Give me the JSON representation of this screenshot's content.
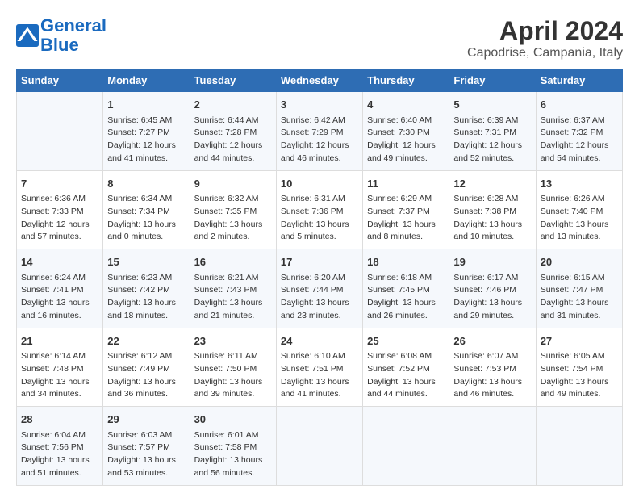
{
  "header": {
    "logo_line1": "General",
    "logo_line2": "Blue",
    "title": "April 2024",
    "subtitle": "Capodrise, Campania, Italy"
  },
  "columns": [
    "Sunday",
    "Monday",
    "Tuesday",
    "Wednesday",
    "Thursday",
    "Friday",
    "Saturday"
  ],
  "weeks": [
    {
      "cells": [
        {
          "day": "",
          "info": ""
        },
        {
          "day": "1",
          "info": "Sunrise: 6:45 AM\nSunset: 7:27 PM\nDaylight: 12 hours\nand 41 minutes."
        },
        {
          "day": "2",
          "info": "Sunrise: 6:44 AM\nSunset: 7:28 PM\nDaylight: 12 hours\nand 44 minutes."
        },
        {
          "day": "3",
          "info": "Sunrise: 6:42 AM\nSunset: 7:29 PM\nDaylight: 12 hours\nand 46 minutes."
        },
        {
          "day": "4",
          "info": "Sunrise: 6:40 AM\nSunset: 7:30 PM\nDaylight: 12 hours\nand 49 minutes."
        },
        {
          "day": "5",
          "info": "Sunrise: 6:39 AM\nSunset: 7:31 PM\nDaylight: 12 hours\nand 52 minutes."
        },
        {
          "day": "6",
          "info": "Sunrise: 6:37 AM\nSunset: 7:32 PM\nDaylight: 12 hours\nand 54 minutes."
        }
      ]
    },
    {
      "cells": [
        {
          "day": "7",
          "info": "Sunrise: 6:36 AM\nSunset: 7:33 PM\nDaylight: 12 hours\nand 57 minutes."
        },
        {
          "day": "8",
          "info": "Sunrise: 6:34 AM\nSunset: 7:34 PM\nDaylight: 13 hours\nand 0 minutes."
        },
        {
          "day": "9",
          "info": "Sunrise: 6:32 AM\nSunset: 7:35 PM\nDaylight: 13 hours\nand 2 minutes."
        },
        {
          "day": "10",
          "info": "Sunrise: 6:31 AM\nSunset: 7:36 PM\nDaylight: 13 hours\nand 5 minutes."
        },
        {
          "day": "11",
          "info": "Sunrise: 6:29 AM\nSunset: 7:37 PM\nDaylight: 13 hours\nand 8 minutes."
        },
        {
          "day": "12",
          "info": "Sunrise: 6:28 AM\nSunset: 7:38 PM\nDaylight: 13 hours\nand 10 minutes."
        },
        {
          "day": "13",
          "info": "Sunrise: 6:26 AM\nSunset: 7:40 PM\nDaylight: 13 hours\nand 13 minutes."
        }
      ]
    },
    {
      "cells": [
        {
          "day": "14",
          "info": "Sunrise: 6:24 AM\nSunset: 7:41 PM\nDaylight: 13 hours\nand 16 minutes."
        },
        {
          "day": "15",
          "info": "Sunrise: 6:23 AM\nSunset: 7:42 PM\nDaylight: 13 hours\nand 18 minutes."
        },
        {
          "day": "16",
          "info": "Sunrise: 6:21 AM\nSunset: 7:43 PM\nDaylight: 13 hours\nand 21 minutes."
        },
        {
          "day": "17",
          "info": "Sunrise: 6:20 AM\nSunset: 7:44 PM\nDaylight: 13 hours\nand 23 minutes."
        },
        {
          "day": "18",
          "info": "Sunrise: 6:18 AM\nSunset: 7:45 PM\nDaylight: 13 hours\nand 26 minutes."
        },
        {
          "day": "19",
          "info": "Sunrise: 6:17 AM\nSunset: 7:46 PM\nDaylight: 13 hours\nand 29 minutes."
        },
        {
          "day": "20",
          "info": "Sunrise: 6:15 AM\nSunset: 7:47 PM\nDaylight: 13 hours\nand 31 minutes."
        }
      ]
    },
    {
      "cells": [
        {
          "day": "21",
          "info": "Sunrise: 6:14 AM\nSunset: 7:48 PM\nDaylight: 13 hours\nand 34 minutes."
        },
        {
          "day": "22",
          "info": "Sunrise: 6:12 AM\nSunset: 7:49 PM\nDaylight: 13 hours\nand 36 minutes."
        },
        {
          "day": "23",
          "info": "Sunrise: 6:11 AM\nSunset: 7:50 PM\nDaylight: 13 hours\nand 39 minutes."
        },
        {
          "day": "24",
          "info": "Sunrise: 6:10 AM\nSunset: 7:51 PM\nDaylight: 13 hours\nand 41 minutes."
        },
        {
          "day": "25",
          "info": "Sunrise: 6:08 AM\nSunset: 7:52 PM\nDaylight: 13 hours\nand 44 minutes."
        },
        {
          "day": "26",
          "info": "Sunrise: 6:07 AM\nSunset: 7:53 PM\nDaylight: 13 hours\nand 46 minutes."
        },
        {
          "day": "27",
          "info": "Sunrise: 6:05 AM\nSunset: 7:54 PM\nDaylight: 13 hours\nand 49 minutes."
        }
      ]
    },
    {
      "cells": [
        {
          "day": "28",
          "info": "Sunrise: 6:04 AM\nSunset: 7:56 PM\nDaylight: 13 hours\nand 51 minutes."
        },
        {
          "day": "29",
          "info": "Sunrise: 6:03 AM\nSunset: 7:57 PM\nDaylight: 13 hours\nand 53 minutes."
        },
        {
          "day": "30",
          "info": "Sunrise: 6:01 AM\nSunset: 7:58 PM\nDaylight: 13 hours\nand 56 minutes."
        },
        {
          "day": "",
          "info": ""
        },
        {
          "day": "",
          "info": ""
        },
        {
          "day": "",
          "info": ""
        },
        {
          "day": "",
          "info": ""
        }
      ]
    }
  ]
}
